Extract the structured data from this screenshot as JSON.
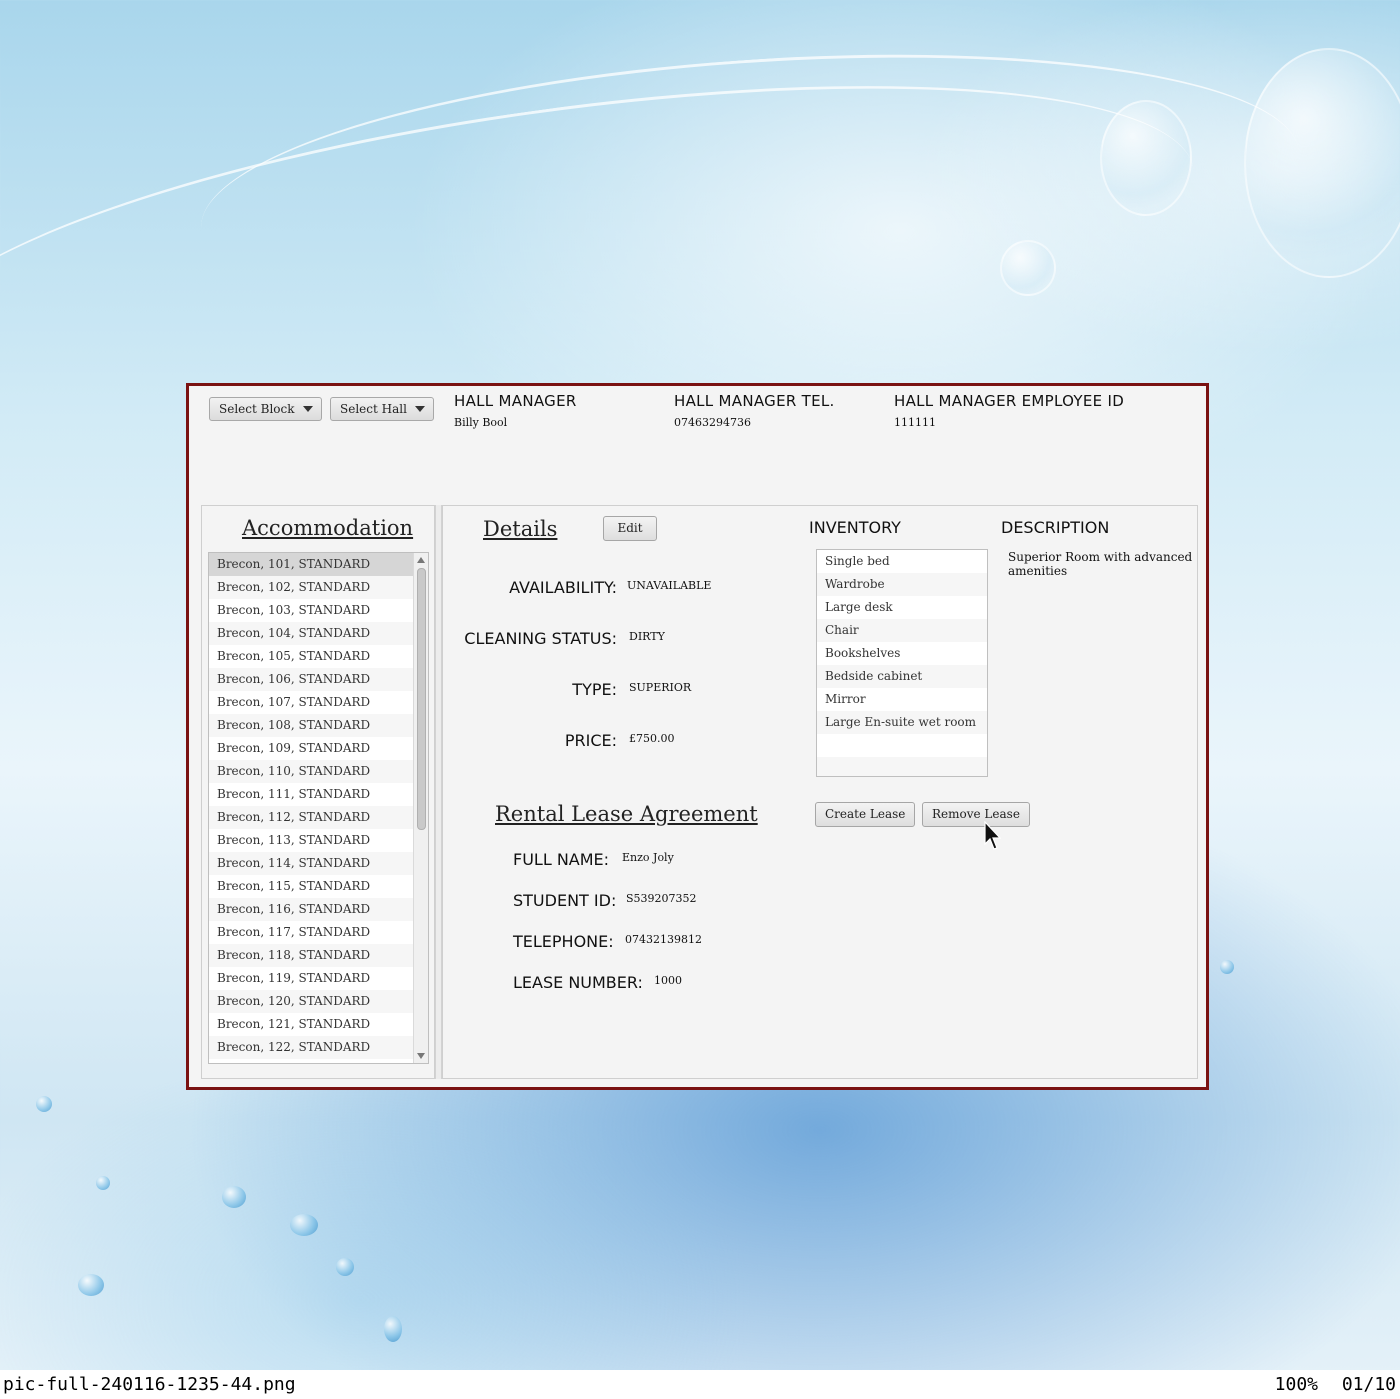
{
  "header": {
    "select_block": "Select Block",
    "select_hall": "Select Hall",
    "hall_manager_label": "HALL MANAGER",
    "hall_manager_value": "Billy Bool",
    "hall_manager_tel_label": "HALL MANAGER TEL.",
    "hall_manager_tel_value": "07463294736",
    "hall_manager_id_label": "HALL MANAGER EMPLOYEE ID",
    "hall_manager_id_value": "111111"
  },
  "accommodation": {
    "title": "Accommodation",
    "items": [
      "Brecon, 101, STANDARD",
      "Brecon, 102, STANDARD",
      "Brecon, 103, STANDARD",
      "Brecon, 104, STANDARD",
      "Brecon, 105, STANDARD",
      "Brecon, 106, STANDARD",
      "Brecon, 107, STANDARD",
      "Brecon, 108, STANDARD",
      "Brecon, 109, STANDARD",
      "Brecon, 110, STANDARD",
      "Brecon, 111, STANDARD",
      "Brecon, 112, STANDARD",
      "Brecon, 113, STANDARD",
      "Brecon, 114, STANDARD",
      "Brecon, 115, STANDARD",
      "Brecon, 116, STANDARD",
      "Brecon, 117, STANDARD",
      "Brecon, 118, STANDARD",
      "Brecon, 119, STANDARD",
      "Brecon, 120, STANDARD",
      "Brecon, 121, STANDARD",
      "Brecon, 122, STANDARD"
    ]
  },
  "details": {
    "title": "Details",
    "edit_label": "Edit",
    "availability_label": "AVAILABILITY:",
    "availability_value": "UNAVAILABLE",
    "cleaning_label": "CLEANING STATUS:",
    "cleaning_value": "DIRTY",
    "type_label": "TYPE:",
    "type_value": "SUPERIOR",
    "price_label": "PRICE:",
    "price_value": "£750.00"
  },
  "inventory": {
    "title": "INVENTORY",
    "items": [
      "Single bed",
      "Wardrobe",
      "Large desk",
      "Chair",
      "Bookshelves",
      "Bedside cabinet",
      "Mirror",
      "Large En-suite wet room"
    ]
  },
  "description": {
    "title": "DESCRIPTION",
    "text": "Superior Room with advanced amenities"
  },
  "lease": {
    "title": "Rental Lease Agreement",
    "create_label": "Create Lease",
    "remove_label": "Remove Lease",
    "full_name_label": "FULL NAME:",
    "full_name_value": "Enzo Joly",
    "student_id_label": "STUDENT ID:",
    "student_id_value": "S539207352",
    "telephone_label": "TELEPHONE:",
    "telephone_value": "07432139812",
    "lease_number_label": "LEASE NUMBER:",
    "lease_number_value": "1000"
  },
  "status_bar": {
    "filename": "pic-full-240116-1235-44.png",
    "zoom": "100%",
    "page": "01/10"
  },
  "colors": {
    "window_border": "#7a1212",
    "panel_bg": "#f4f4f4",
    "selected_row": "#d6d6d6"
  }
}
